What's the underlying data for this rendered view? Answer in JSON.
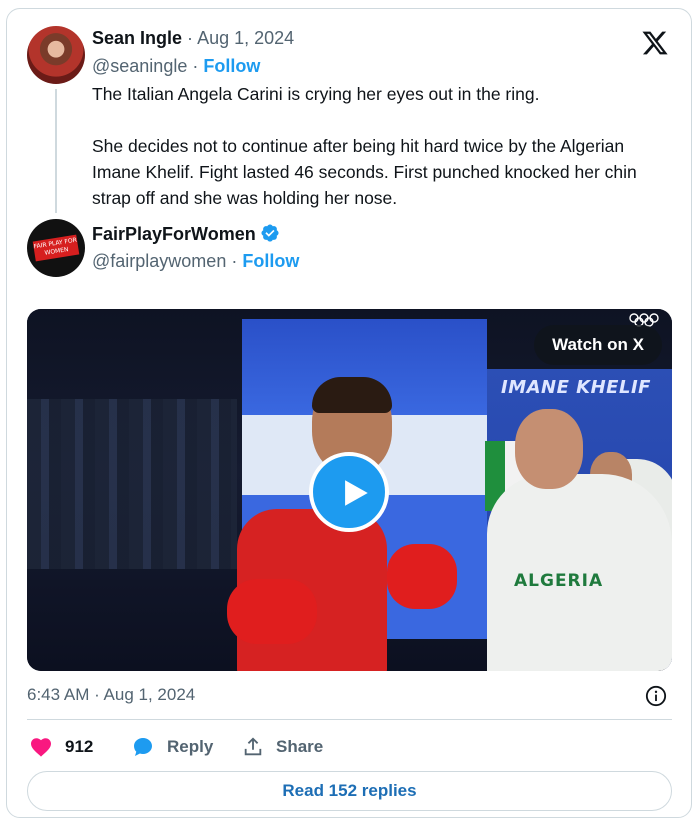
{
  "original_tweet": {
    "author_name": "Sean Ingle",
    "separator": "·",
    "date": "Aug 1, 2024",
    "handle": "@seaningle",
    "follow_label": "Follow",
    "text_paragraphs": [
      "The Italian Angela Carini is crying her eyes out in the ring.",
      "She decides not to continue after being hit hard twice by the Algerian Imane Khelif. Fight lasted 46 seconds. First punched knocked her chin strap off and she was holding her nose."
    ],
    "avatar_icon": "profile-photo"
  },
  "quoted_account": {
    "author_name": "FairPlayForWomen",
    "verified": true,
    "separator": "·",
    "handle": "@fairplaywomen",
    "follow_label": "Follow",
    "avatar_text": "FAIR PLAY FOR WOMEN",
    "verified_color": "#1d9bf0"
  },
  "media": {
    "watch_label": "Watch on X",
    "scoreboard_text": "IMANE KHELIF",
    "shirt_text": "ALGERIA",
    "play_icon": "play-icon",
    "olympic_icon": "olympic-rings-icon"
  },
  "footer": {
    "timestamp": "6:43 AM · Aug 1, 2024",
    "likes_count": "912",
    "reply_label": "Reply",
    "share_label": "Share",
    "read_replies_label": "Read 152 replies"
  },
  "colors": {
    "accent": "#1d9bf0",
    "like": "#f91880",
    "muted": "#536471"
  }
}
